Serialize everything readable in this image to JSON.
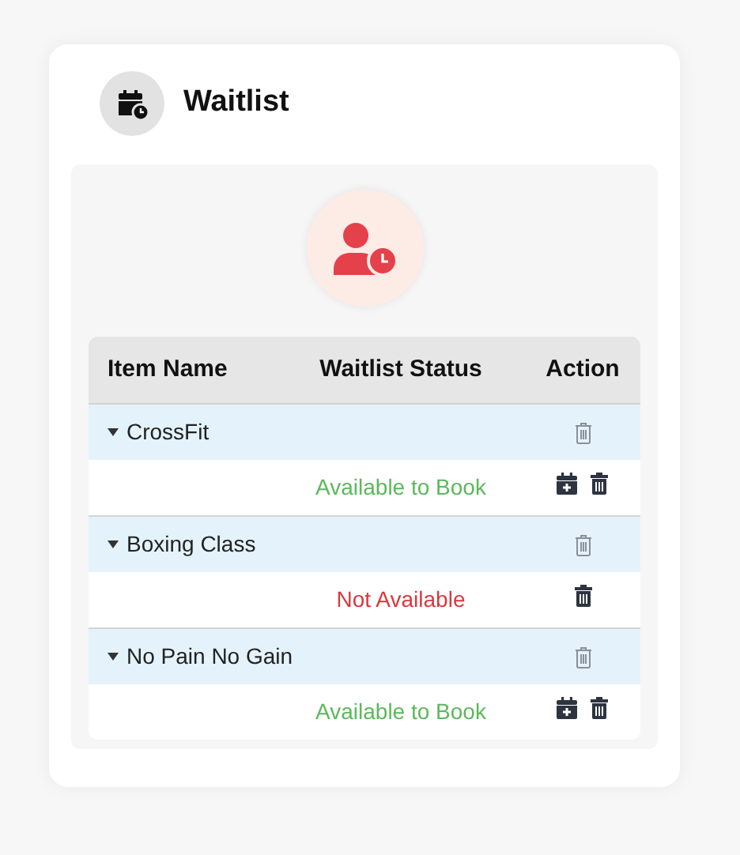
{
  "title": "Waitlist",
  "table": {
    "columns": [
      "Item Name",
      "Waitlist Status",
      "Action"
    ],
    "rows": [
      {
        "name": "CrossFit",
        "expanded": true,
        "status": "Available to Book",
        "available": true
      },
      {
        "name": "Boxing Class",
        "expanded": true,
        "status": "Not Available",
        "available": false
      },
      {
        "name": "No Pain No Gain",
        "expanded": true,
        "status": "Available to Book",
        "available": true
      }
    ]
  }
}
